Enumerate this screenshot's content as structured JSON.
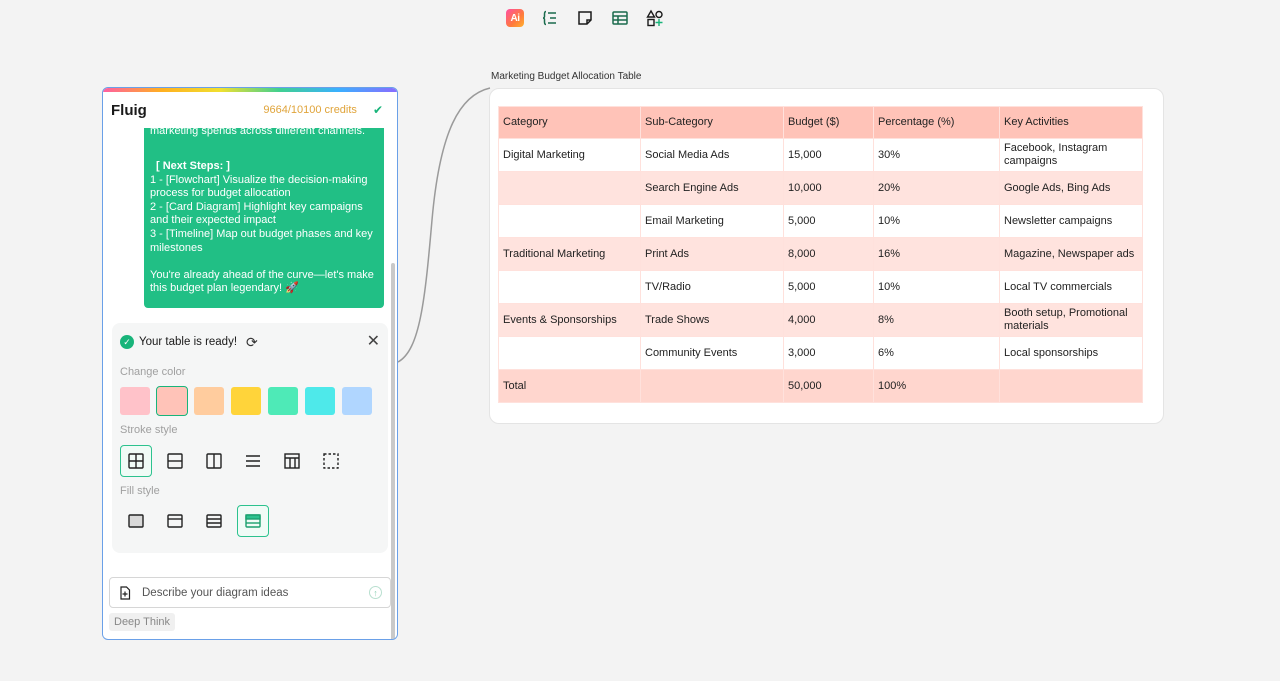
{
  "toolbar": {
    "items": [
      {
        "name": "ai-tool",
        "label": "Ai"
      },
      {
        "name": "mindmap-tool"
      },
      {
        "name": "sticky-note-tool"
      },
      {
        "name": "table-tool"
      },
      {
        "name": "shapes-tool"
      }
    ]
  },
  "panel": {
    "title": "Fluig",
    "credits": "9664/10100 credits",
    "message": {
      "cut_line": "marketing spends across different channels.",
      "next_steps_label": "[ Next Steps: ]",
      "steps": [
        "1 - [Flowchart] Visualize the decision-making process for budget allocation",
        "2 - [Card Diagram] Highlight key campaigns and their expected impact",
        "3 - [Timeline] Map out budget phases and key milestones"
      ],
      "closing": "You're already ahead of the curve—let's make this budget plan legendary! 🚀"
    },
    "settings": {
      "ready_text": "Your table is ready!",
      "change_color_label": "Change color",
      "colors": [
        "#ffc2c9",
        "#ffc3b8",
        "#ffcc9e",
        "#ffd43a",
        "#4eeab7",
        "#4ee9ea",
        "#b0d6ff"
      ],
      "selected_color_index": 1,
      "stroke_style_label": "Stroke style",
      "stroke_styles": [
        "all-borders",
        "horizontal-borders",
        "vertical-borders",
        "row-lines",
        "header-borders",
        "no-borders"
      ],
      "selected_stroke_index": 0,
      "fill_style_label": "Fill style",
      "fill_styles": [
        "solid-fill",
        "header-fill",
        "striped-fill",
        "header-striped-fill"
      ],
      "selected_fill_index": 3
    },
    "input_placeholder": "Describe your diagram ideas",
    "deep_think_label": "Deep Think"
  },
  "diagram": {
    "title": "Marketing Budget Allocation Table",
    "headers": [
      "Category",
      "Sub-Category",
      "Budget ($)",
      "Percentage (%)",
      "Key Activities"
    ],
    "rows": [
      [
        "Digital Marketing",
        "Social Media Ads",
        "15,000",
        "30%",
        "Facebook, Instagram campaigns"
      ],
      [
        "",
        "Search Engine Ads",
        "10,000",
        "20%",
        "Google Ads, Bing Ads"
      ],
      [
        "",
        "Email Marketing",
        "5,000",
        "10%",
        "Newsletter campaigns"
      ],
      [
        "Traditional Marketing",
        "Print Ads",
        "8,000",
        "16%",
        "Magazine, Newspaper ads"
      ],
      [
        "",
        "TV/Radio",
        "5,000",
        "10%",
        "Local TV commercials"
      ],
      [
        "Events & Sponsorships",
        "Trade Shows",
        "4,000",
        "8%",
        "Booth setup, Promotional materials"
      ],
      [
        "",
        "Community Events",
        "3,000",
        "6%",
        "Local sponsorships"
      ],
      [
        "Total",
        "",
        "50,000",
        "100%",
        ""
      ]
    ]
  }
}
